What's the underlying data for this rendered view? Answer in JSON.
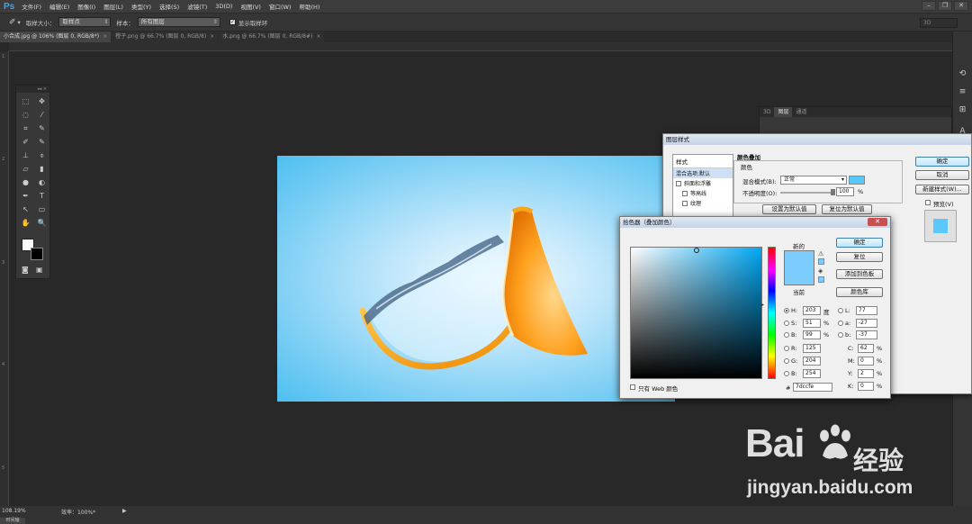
{
  "app": {
    "logo": "Ps"
  },
  "menubar": {
    "items": [
      "文件(F)",
      "编辑(E)",
      "图像(I)",
      "图层(L)",
      "类型(Y)",
      "选择(S)",
      "滤镜(T)",
      "3D(D)",
      "视图(V)",
      "窗口(W)",
      "帮助(H)"
    ]
  },
  "window_controls": {
    "minimize": "–",
    "restore": "❐",
    "close": "✕"
  },
  "options_bar": {
    "sample_size_label": "取样大小：",
    "sample_size_value": "取样点",
    "sample_label": "样本：",
    "sample_value": "所有图层",
    "show_ring_label": "显示取样环",
    "workspace": "3D"
  },
  "tabs": [
    {
      "label": "小合成.jpg @ 106% (图层 0, RGB/8*)",
      "close": "×"
    },
    {
      "label": "橙子.png @ 66.7% (图层 0, RGB/8)",
      "close": "×"
    },
    {
      "label": "水.png @ 66.7% (图层 0, RGB/8#)",
      "close": "×"
    }
  ],
  "ruler_left": [
    "1",
    "2",
    "3",
    "4",
    "5"
  ],
  "toolbox": {
    "header": "◂◂ ×",
    "tools": [
      "⬚",
      "✥",
      "◌",
      "⁄",
      "⌗",
      "✎",
      "✐",
      "✎",
      "⊥",
      "⌽",
      "▱",
      "▮",
      "●",
      "◐",
      "✒",
      "T",
      "↖",
      "▭",
      "✋",
      "🔍"
    ]
  },
  "background_panel": {
    "tabs": [
      "3D",
      "图层",
      "通道"
    ]
  },
  "layer_style": {
    "title": "图层样式",
    "styles_header": "样式",
    "styles_items": [
      "混合选项:默认",
      "斜面和浮雕",
      "等高线",
      "纹理"
    ],
    "section_title": "颜色叠加",
    "group_title": "颜色",
    "blend_mode_label": "混合模式(B):",
    "blend_mode_value": "正常",
    "opacity_label": "不透明度(O):",
    "opacity_value": "100",
    "opacity_unit": "%",
    "set_default": "设置为默认值",
    "reset_default": "复位为默认值",
    "ok": "确定",
    "cancel": "取消",
    "new_style": "新建样式(W)...",
    "preview_label": "预览(V)",
    "overlay_color": "#5ac8fa"
  },
  "color_picker": {
    "title": "拾色器（叠加颜色）",
    "new_label": "新的",
    "current_label": "当前",
    "ok": "确定",
    "reset": "复位",
    "add_swatches": "添加到色板",
    "color_libraries": "颜色库",
    "web_only_label": "只有 Web 颜色",
    "hsb": [
      {
        "label": "H:",
        "value": "203",
        "unit": "度"
      },
      {
        "label": "S:",
        "value": "51",
        "unit": "%"
      },
      {
        "label": "B:",
        "value": "99",
        "unit": "%"
      }
    ],
    "rgb": [
      {
        "label": "R:",
        "value": "125"
      },
      {
        "label": "G:",
        "value": "204"
      },
      {
        "label": "B:",
        "value": "254"
      }
    ],
    "lab": [
      {
        "label": "L:",
        "value": "77"
      },
      {
        "label": "a:",
        "value": "-27"
      },
      {
        "label": "b:",
        "value": "-37"
      }
    ],
    "cmyk": [
      {
        "label": "C:",
        "value": "62",
        "unit": "%"
      },
      {
        "label": "M:",
        "value": "0",
        "unit": "%"
      },
      {
        "label": "Y:",
        "value": "2",
        "unit": "%"
      },
      {
        "label": "K:",
        "value": "0",
        "unit": "%"
      }
    ],
    "hex_label": "#",
    "hex_value": "7dccfe",
    "color": "#7dccfe"
  },
  "statusbar": {
    "zoom": "108.19%",
    "doc_info": "效率：100%*",
    "arrow": "▶",
    "timeline": "时间轴"
  },
  "watermark": {
    "brand": "Bai",
    "cn": "经验",
    "url": "jingyan.baidu.com"
  }
}
